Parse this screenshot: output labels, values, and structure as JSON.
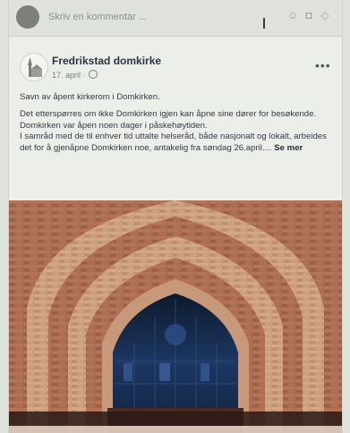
{
  "comment_bar": {
    "placeholder": "Skriv en kommentar ..."
  },
  "post": {
    "page_name": "Fredrikstad domkirke",
    "date": "17. april ·",
    "paragraphs": [
      "Savn av åpent kirkerom i Domkirken.",
      "Det etterspørres om ikke Domkirken igjen kan åpne sine dører for besøkende.",
      "Domkirken var åpen noen dager i påskehøytiden.",
      "I samråd med de til enhver tid uttalte helseråd, både nasjonalt og lokalt, arbeides det for å gjenåpne Domkirken noe, antakelig fra søndag 26.april...."
    ],
    "see_more": "Se mer"
  },
  "icons": {
    "comment_bar": [
      "avatar",
      "emoji-icon",
      "camera-icon",
      "gif-icon"
    ],
    "header": [
      "globe-icon",
      "more-options-icon"
    ]
  },
  "photo": {
    "subject": "church-portal-image"
  }
}
